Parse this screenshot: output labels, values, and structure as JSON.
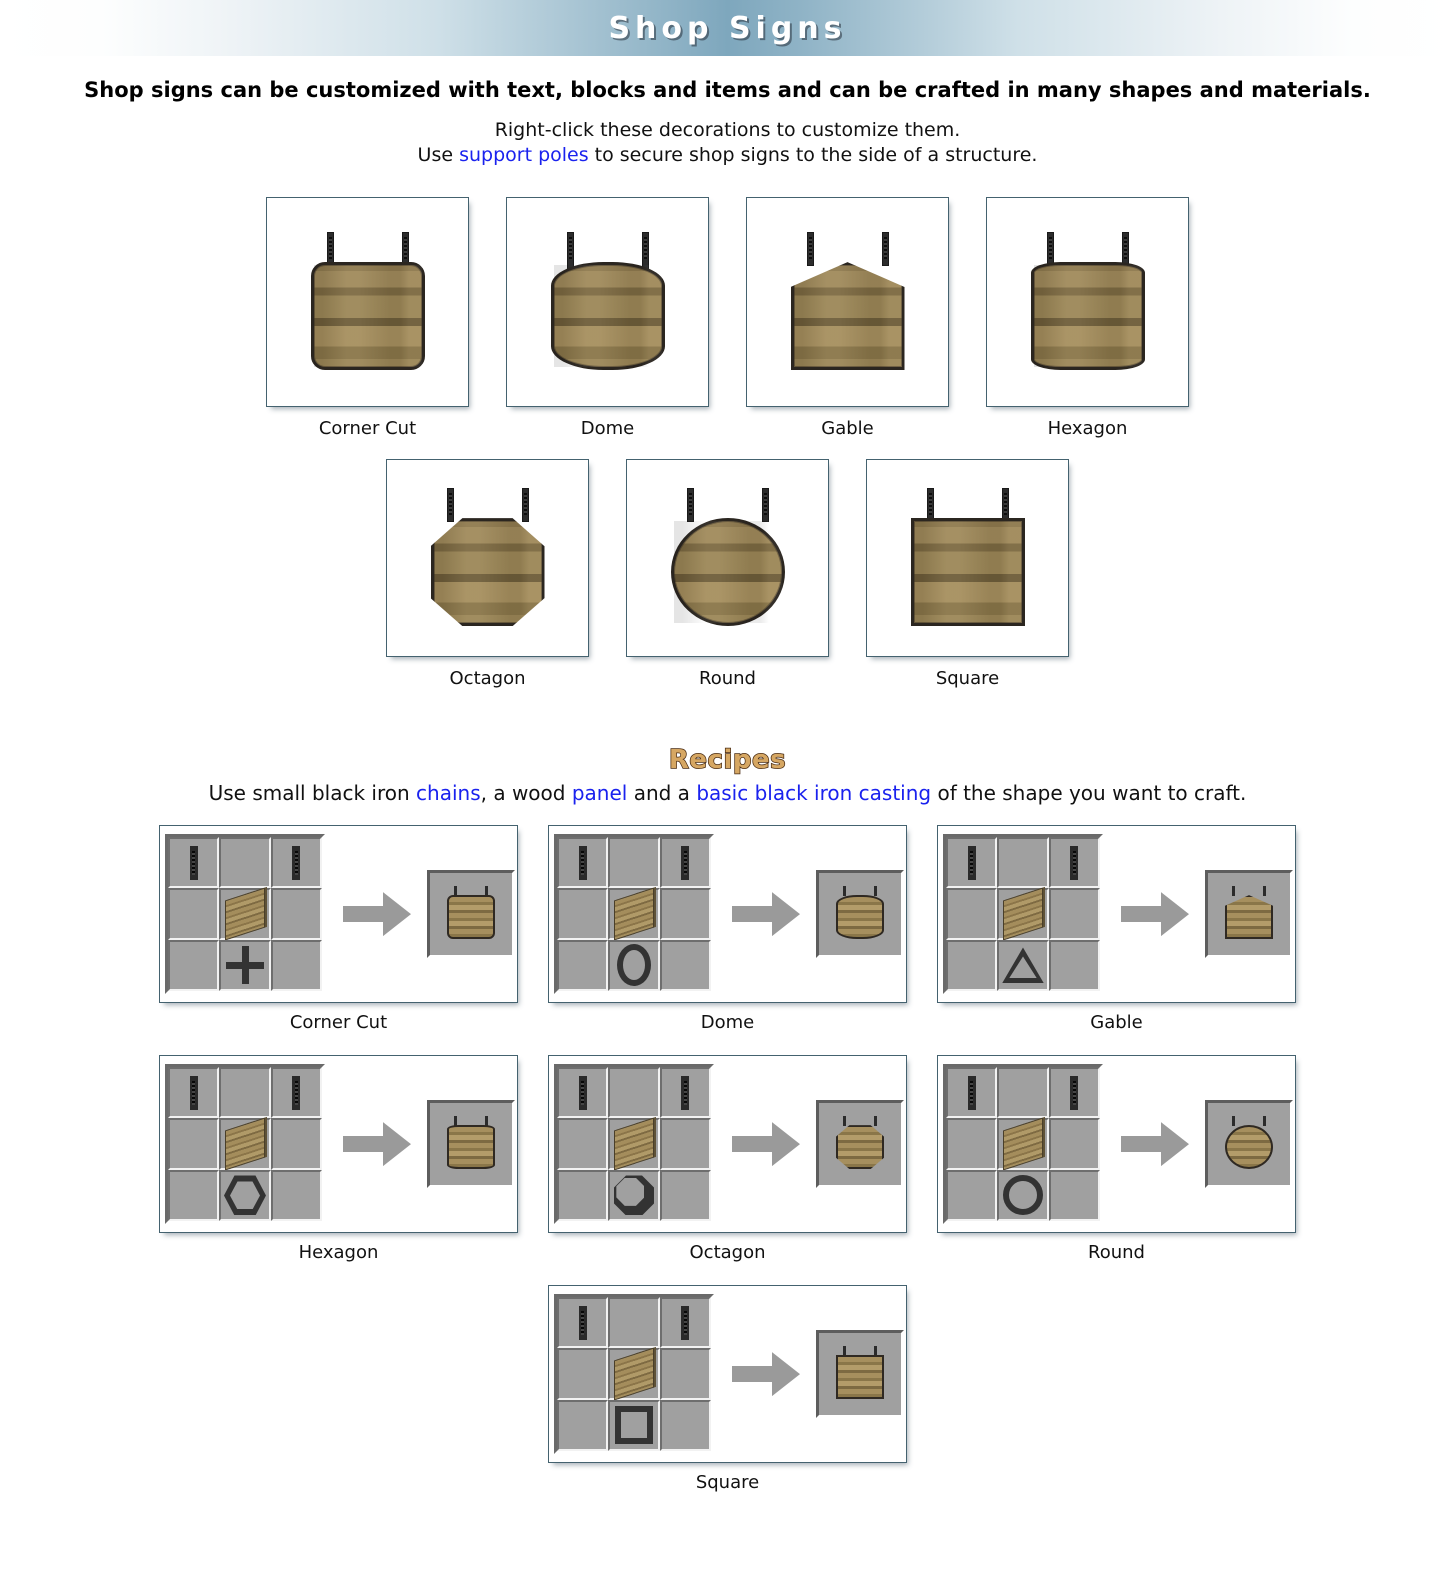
{
  "header": {
    "title": "Shop Signs"
  },
  "intro": {
    "lead": "Shop signs can be customized with text, blocks and items and can be crafted in many shapes and materials.",
    "line1": "Right-click these decorations to customize them.",
    "line2_pre": "Use ",
    "line2_link": "support poles",
    "line2_post": " to secure shop signs to the side of a structure."
  },
  "gallery": {
    "row1": [
      {
        "label": "Corner Cut",
        "shape": "cornercut"
      },
      {
        "label": "Dome",
        "shape": "dome"
      },
      {
        "label": "Gable",
        "shape": "gable"
      },
      {
        "label": "Hexagon",
        "shape": "hexagon"
      }
    ],
    "row2": [
      {
        "label": "Octagon",
        "shape": "octagon"
      },
      {
        "label": "Round",
        "shape": "round"
      },
      {
        "label": "Square",
        "shape": "square"
      }
    ]
  },
  "recipes": {
    "title": "Recipes",
    "sub_part1": "Use small black iron ",
    "sub_link1": "chains",
    "sub_part2": ", a wood ",
    "sub_link2": "panel",
    "sub_part3": " and a ",
    "sub_link3": "basic black iron casting",
    "sub_part4": " of the shape you want to craft.",
    "items": [
      {
        "label": "Corner Cut",
        "shape": "cornercut",
        "casting": "plus-casting",
        "ingredients": [
          "small black iron chain",
          "wood panel",
          "basic black iron casting"
        ]
      },
      {
        "label": "Dome",
        "shape": "dome",
        "casting": "oval-casting",
        "ingredients": [
          "small black iron chain",
          "wood panel",
          "basic black iron casting"
        ]
      },
      {
        "label": "Gable",
        "shape": "gable",
        "casting": "triangle-casting",
        "ingredients": [
          "small black iron chain",
          "wood panel",
          "basic black iron casting"
        ]
      },
      {
        "label": "Hexagon",
        "shape": "hexagon",
        "casting": "hexagon-casting",
        "ingredients": [
          "small black iron chain",
          "wood panel",
          "basic black iron casting"
        ]
      },
      {
        "label": "Octagon",
        "shape": "octagon",
        "casting": "octagon-casting",
        "ingredients": [
          "small black iron chain",
          "wood panel",
          "basic black iron casting"
        ]
      },
      {
        "label": "Round",
        "shape": "round",
        "casting": "circle-casting",
        "ingredients": [
          "small black iron chain",
          "wood panel",
          "basic black iron casting"
        ]
      },
      {
        "label": "Square",
        "shape": "square",
        "casting": "square-casting",
        "ingredients": [
          "small black iron chain",
          "wood panel",
          "basic black iron casting"
        ]
      }
    ]
  },
  "colors": {
    "header_gradient_center": "#7ea7bd",
    "title_text": "#ffffff",
    "link": "#1a22ee",
    "recipes_title_fill": "#d6a763",
    "recipes_title_stroke": "#4a2c13",
    "frame_border": "#44626f",
    "slot_background": "#a0a0a0",
    "wood": "#a68f5e",
    "iron": "#2b2b2b"
  }
}
